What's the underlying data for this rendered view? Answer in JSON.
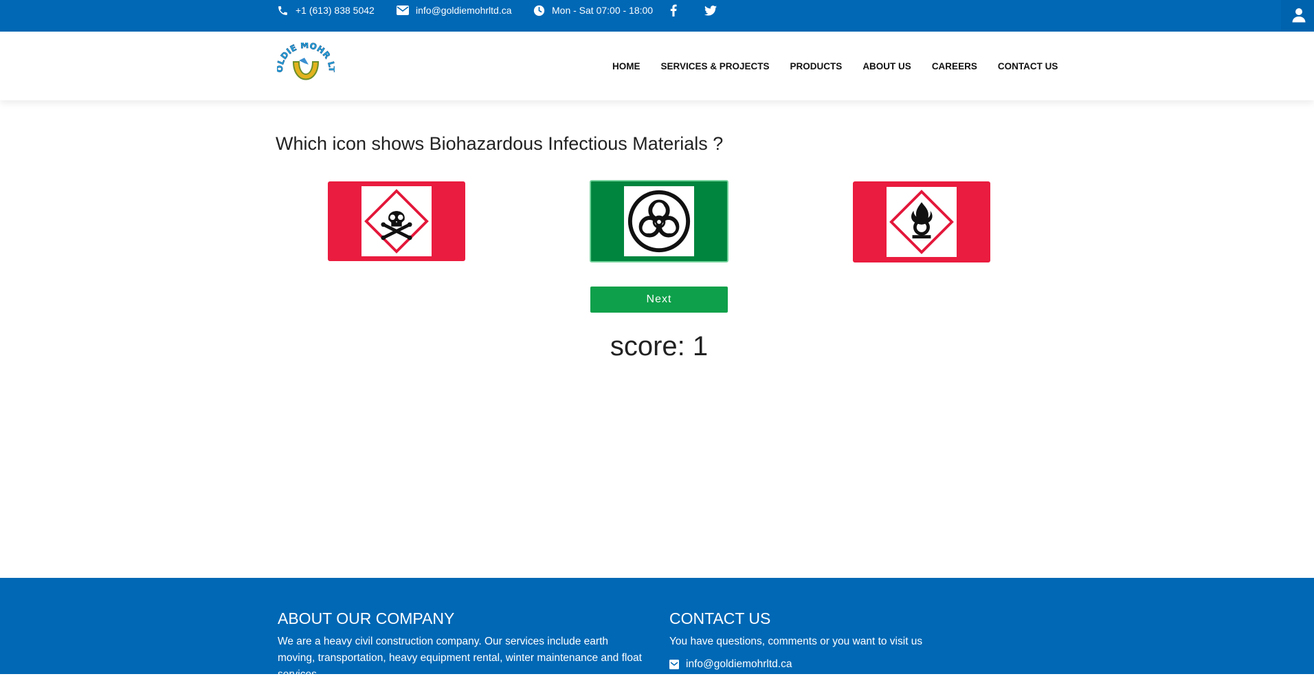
{
  "topbar": {
    "phone": "+1 (613) 838 5042",
    "email": "info@goldiemohrltd.ca",
    "hours": "Mon - Sat 07:00 - 18:00",
    "icons": [
      "phone-icon",
      "envelope-icon",
      "clock-icon",
      "facebook-icon",
      "twitter-icon",
      "user-icon"
    ]
  },
  "header": {
    "logo_text": "GOLDIE MOHR LTD",
    "nav": [
      "HOME",
      "SERVICES & PROJECTS",
      "PRODUCTS",
      "ABOUT US",
      "CAREERS",
      "CONTACT US"
    ]
  },
  "quiz": {
    "question": "Which icon shows Biohazardous Infectious Materials ?",
    "options": [
      {
        "icon": "skull-crossbones-icon",
        "color": "#ea1c3f",
        "selected": false
      },
      {
        "icon": "biohazard-icon",
        "color": "#00853e",
        "selected": true
      },
      {
        "icon": "flame-over-circle-icon",
        "color": "#ea1c3f",
        "selected": false
      }
    ],
    "next_label": "Next",
    "score_label": "score: 1"
  },
  "footer": {
    "about_title": "ABOUT OUR COMPANY",
    "about_text": "We are a heavy civil construction company. Our services include earth moving, transportation, heavy equipment rental, winter maintenance and float services.",
    "contact_title": "CONTACT US",
    "contact_text": "You have questions, comments or you want to visit us",
    "contact_email": "info@goldiemohrltd.ca"
  },
  "colors": {
    "brand_blue": "#0068b5",
    "hazard_red": "#ea1c3f",
    "correct_green": "#00853e",
    "button_green": "#0ea04a"
  }
}
